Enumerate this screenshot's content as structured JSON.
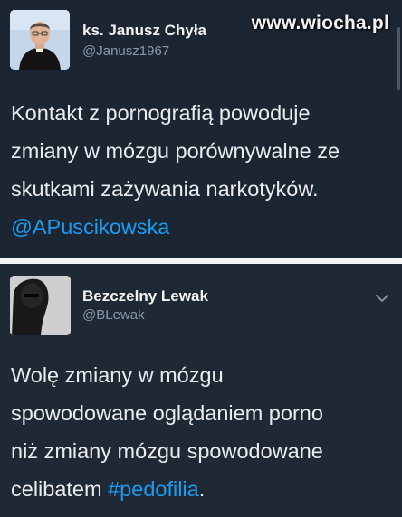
{
  "watermark": "www.wiocha.pl",
  "tweets": [
    {
      "display_name": "ks. Janusz Chyła",
      "handle": "@Janusz1967",
      "text": "Kontakt z pornografią powoduje zmiany w mózgu porównywalne ze skutkami zażywania narkotyków.",
      "lines": [
        "Kontakt z pornografią powoduje",
        "zmiany w mózgu porównywalne ze",
        "skutkami zażywania narkotyków."
      ],
      "mention": "@APuscikowska",
      "avatar_icon": "priest-avatar"
    },
    {
      "display_name": "Bezczelny Lewak",
      "handle": "@BLewak",
      "lines": [
        "Wolę zmiany w mózgu",
        "spowodowane oglądaniem porno",
        "niż zmiany mózgu spowodowane"
      ],
      "last_line_prefix": "celibatem ",
      "hashtag": "#pedofilia",
      "last_line_suffix": ".",
      "avatar_icon": "dark-figure-avatar",
      "menu_icon": "chevron-down-icon"
    }
  ],
  "colors": {
    "background": "#1e2834",
    "link": "#1d9bf0",
    "separator": "#f4f4f4"
  }
}
